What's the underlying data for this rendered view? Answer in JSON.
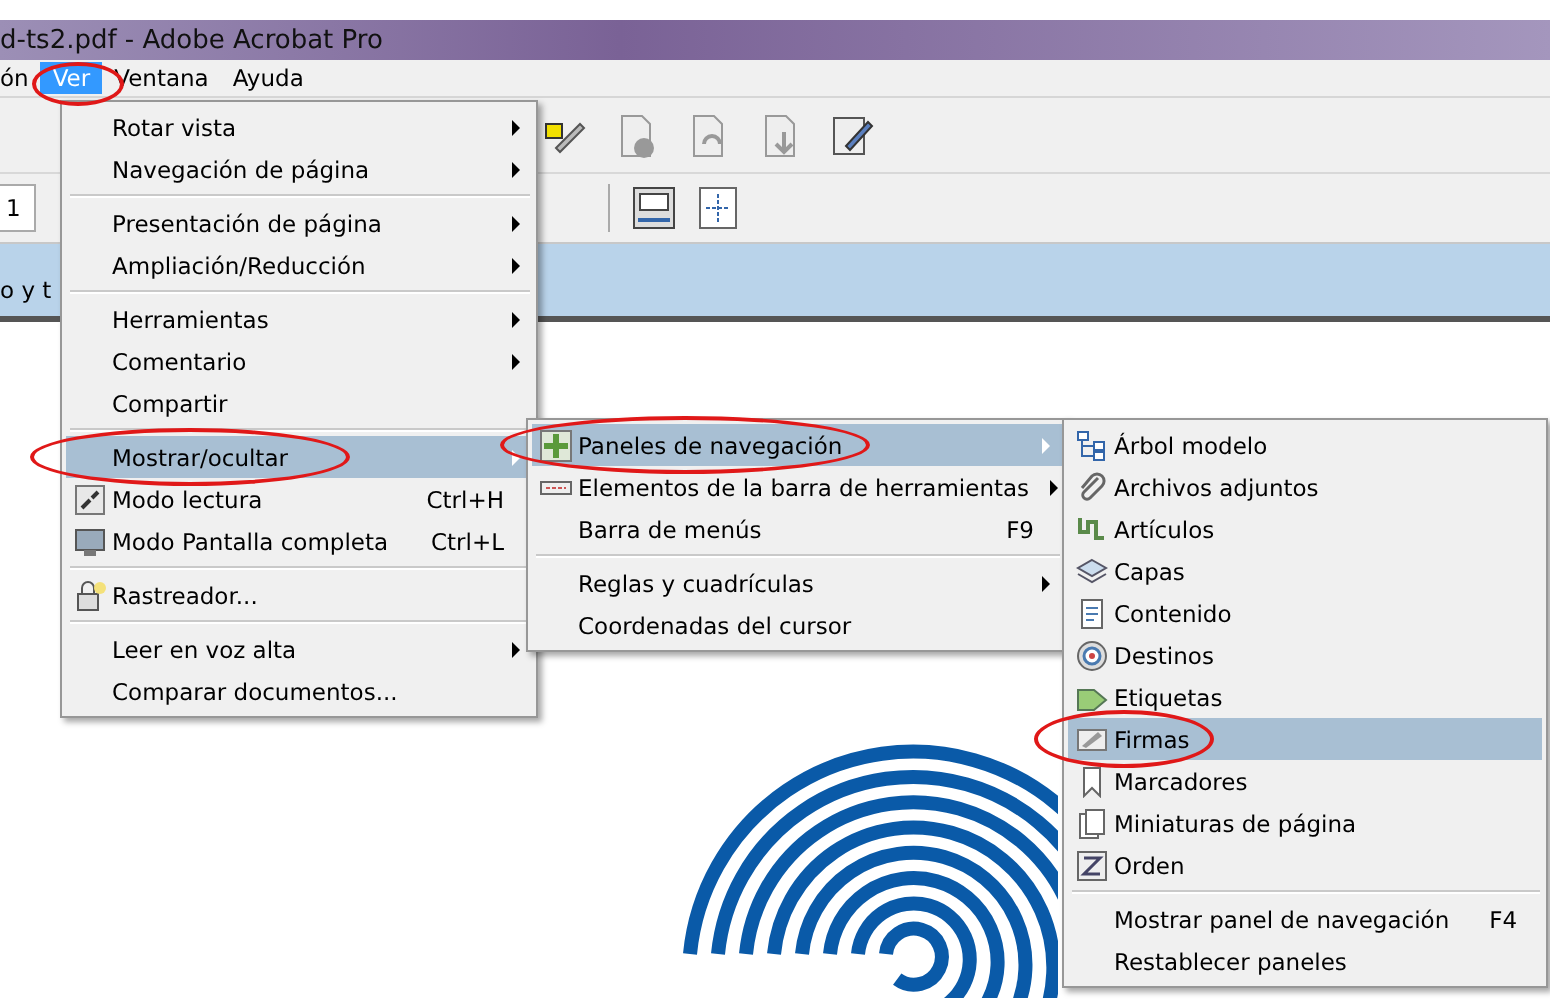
{
  "window": {
    "title": "d-ts2.pdf - Adobe Acrobat Pro"
  },
  "menubar": [
    {
      "label": "ón",
      "selected": false,
      "circled": false
    },
    {
      "label": "Ver",
      "selected": true,
      "circled": true
    },
    {
      "label": "Ventana",
      "selected": false,
      "circled": false
    },
    {
      "label": "Ayuda",
      "selected": false,
      "circled": false
    }
  ],
  "toolbar": {
    "page_field": {
      "value": "1"
    }
  },
  "banner": {
    "text": "o y t"
  },
  "menus": [
    {
      "items": [
        {
          "kind": "item",
          "label": "Rotar vista",
          "submenu": true,
          "selected": false,
          "circled": false
        },
        {
          "kind": "item",
          "label": "Navegación de página",
          "submenu": true,
          "selected": false,
          "circled": false
        },
        {
          "kind": "separator"
        },
        {
          "kind": "item",
          "label": "Presentación de página",
          "submenu": true,
          "selected": false,
          "circled": false
        },
        {
          "kind": "item",
          "label": "Ampliación/Reducción",
          "submenu": true,
          "selected": false,
          "circled": false
        },
        {
          "kind": "separator"
        },
        {
          "kind": "item",
          "label": "Herramientas",
          "submenu": true,
          "selected": false,
          "circled": false
        },
        {
          "kind": "item",
          "label": "Comentario",
          "submenu": true,
          "selected": false,
          "circled": false
        },
        {
          "kind": "item",
          "label": "Compartir",
          "submenu": false,
          "selected": false,
          "circled": false
        },
        {
          "kind": "separator"
        },
        {
          "kind": "item",
          "label": "Mostrar/ocultar",
          "submenu": true,
          "selected": true,
          "circled": true
        },
        {
          "kind": "item",
          "label": "Modo lectura",
          "shortcut": "Ctrl+H",
          "submenu": false,
          "selected": false,
          "circled": false
        },
        {
          "kind": "item",
          "label": "Modo Pantalla completa",
          "shortcut": "Ctrl+L",
          "submenu": false,
          "selected": false,
          "circled": false
        },
        {
          "kind": "separator"
        },
        {
          "kind": "item",
          "label": "Rastreador...",
          "submenu": false,
          "selected": false,
          "circled": false
        },
        {
          "kind": "separator"
        },
        {
          "kind": "item",
          "label": "Leer en voz alta",
          "submenu": true,
          "selected": false,
          "circled": false
        },
        {
          "kind": "item",
          "label": "Comparar documentos...",
          "submenu": false,
          "selected": false,
          "circled": false
        }
      ]
    },
    {
      "items": [
        {
          "kind": "item",
          "label": "Paneles de navegación",
          "submenu": true,
          "selected": true,
          "circled": true
        },
        {
          "kind": "item",
          "label": "Elementos de la barra de herramientas",
          "submenu": true,
          "selected": false,
          "circled": false
        },
        {
          "kind": "item",
          "label": "Barra de menús",
          "shortcut": "F9",
          "submenu": false,
          "selected": false,
          "circled": false
        },
        {
          "kind": "separator"
        },
        {
          "kind": "item",
          "label": "Reglas y cuadrículas",
          "submenu": true,
          "selected": false,
          "circled": false
        },
        {
          "kind": "item",
          "label": "Coordenadas del cursor",
          "submenu": false,
          "selected": false,
          "circled": false
        }
      ]
    },
    {
      "items": [
        {
          "kind": "item",
          "label": "Árbol modelo",
          "submenu": false,
          "selected": false,
          "circled": false
        },
        {
          "kind": "item",
          "label": "Archivos adjuntos",
          "submenu": false,
          "selected": false,
          "circled": false
        },
        {
          "kind": "item",
          "label": "Artículos",
          "submenu": false,
          "selected": false,
          "circled": false
        },
        {
          "kind": "item",
          "label": "Capas",
          "submenu": false,
          "selected": false,
          "circled": false
        },
        {
          "kind": "item",
          "label": "Contenido",
          "submenu": false,
          "selected": false,
          "circled": false
        },
        {
          "kind": "item",
          "label": "Destinos",
          "submenu": false,
          "selected": false,
          "circled": false
        },
        {
          "kind": "item",
          "label": "Etiquetas",
          "submenu": false,
          "selected": false,
          "circled": false
        },
        {
          "kind": "item",
          "label": "Firmas",
          "submenu": false,
          "selected": true,
          "circled": true
        },
        {
          "kind": "item",
          "label": "Marcadores",
          "submenu": false,
          "selected": false,
          "circled": false
        },
        {
          "kind": "item",
          "label": "Miniaturas de página",
          "submenu": false,
          "selected": false,
          "circled": false
        },
        {
          "kind": "item",
          "label": "Orden",
          "submenu": false,
          "selected": false,
          "circled": false
        },
        {
          "kind": "separator"
        },
        {
          "kind": "item",
          "label": "Mostrar panel de navegación",
          "shortcut": "F4",
          "submenu": false,
          "selected": false,
          "circled": false
        },
        {
          "kind": "item",
          "label": "Restablecer paneles",
          "submenu": false,
          "selected": false,
          "circled": false
        }
      ]
    }
  ]
}
